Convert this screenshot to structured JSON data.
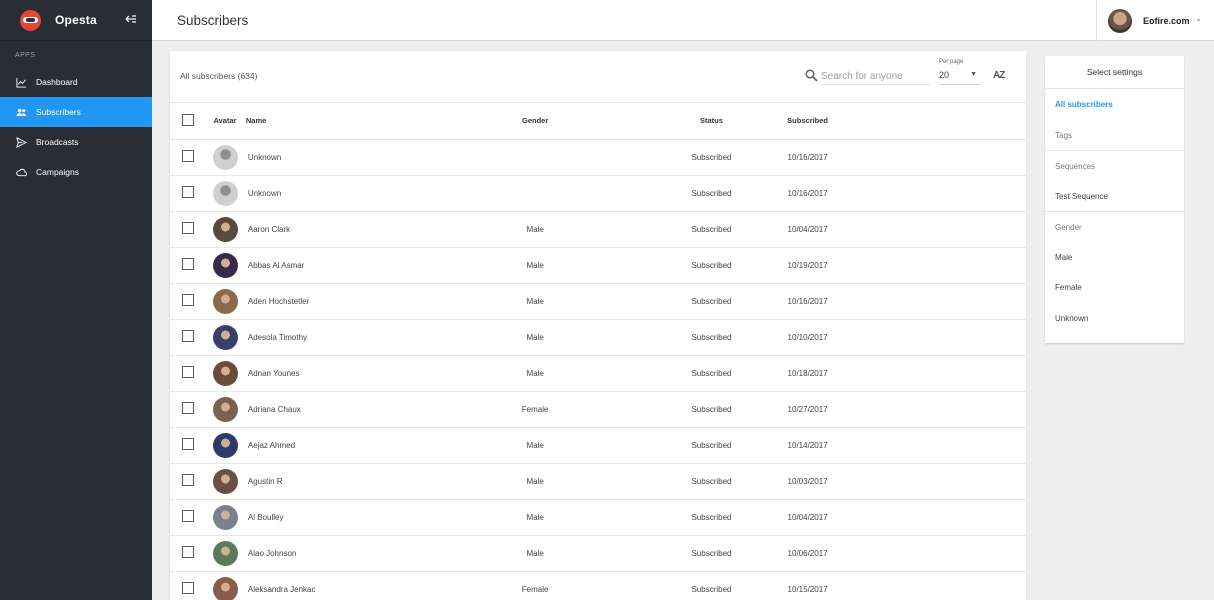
{
  "brand": {
    "name": "Opesta"
  },
  "sidebar": {
    "section_label": "APPS",
    "items": [
      {
        "label": "Dashboard",
        "icon": "chart-line-icon"
      },
      {
        "label": "Subscribers",
        "icon": "people-icon"
      },
      {
        "label": "Broadcasts",
        "icon": "send-icon"
      },
      {
        "label": "Campaigns",
        "icon": "cloud-icon"
      }
    ]
  },
  "header": {
    "title": "Subscribers",
    "user_name": "Eofire.com"
  },
  "toolbar": {
    "all_count": "All subscribers (634)",
    "search_placeholder": "Search for anyone",
    "per_page_label": "Per page",
    "per_page_value": "20",
    "sort_label": "AZ"
  },
  "table": {
    "headers": {
      "avatar": "Avatar",
      "name": "Name",
      "gender": "Gender",
      "status": "Status",
      "subscribed": "Subscribed"
    },
    "rows": [
      {
        "name": "Unknown",
        "gender": "",
        "status": "Subscribed",
        "date": "10/16/2017",
        "color": "#9e9e9e"
      },
      {
        "name": "Unknown",
        "gender": "",
        "status": "Subscribed",
        "date": "10/16/2017",
        "color": "#9e9e9e"
      },
      {
        "name": "Aaron Clark",
        "gender": "Male",
        "status": "Subscribed",
        "date": "10/04/2017",
        "color": "#5a4a3e"
      },
      {
        "name": "Abbas Al Asmar",
        "gender": "Male",
        "status": "Subscribed",
        "date": "10/19/2017",
        "color": "#3a2a4a"
      },
      {
        "name": "Aden Hochstetler",
        "gender": "Male",
        "status": "Subscribed",
        "date": "10/16/2017",
        "color": "#8a6a4a"
      },
      {
        "name": "Adesola Timothy",
        "gender": "Male",
        "status": "Subscribed",
        "date": "10/10/2017",
        "color": "#3b3d6b"
      },
      {
        "name": "Adnan Younes",
        "gender": "Male",
        "status": "Subscribed",
        "date": "10/18/2017",
        "color": "#6b4a3a"
      },
      {
        "name": "Adriana Chaux",
        "gender": "Female",
        "status": "Subscribed",
        "date": "10/27/2017",
        "color": "#7a6050"
      },
      {
        "name": "Aejaz Ahmed",
        "gender": "Male",
        "status": "Subscribed",
        "date": "10/14/2017",
        "color": "#2a3a6a"
      },
      {
        "name": "Agustin R",
        "gender": "Male",
        "status": "Subscribed",
        "date": "10/03/2017",
        "color": "#6a5040"
      },
      {
        "name": "Al Boulley",
        "gender": "Male",
        "status": "Subscribed",
        "date": "10/04/2017",
        "color": "#7a8090"
      },
      {
        "name": "Alao Johnson",
        "gender": "Male",
        "status": "Subscribed",
        "date": "10/06/2017",
        "color": "#5a7a5a"
      },
      {
        "name": "Aleksandra Jenkac",
        "gender": "Female",
        "status": "Subscribed",
        "date": "10/15/2017",
        "color": "#8a5a4a"
      }
    ]
  },
  "settings": {
    "title": "Select settings",
    "all": "All subscribers",
    "tags": "Tags",
    "sequences": "Sequences",
    "test_sequence": "Test Sequence",
    "gender": "Gender",
    "male": "Male",
    "female": "Female",
    "unknown": "Unknown"
  },
  "colors": {
    "accent": "#2196f3",
    "sidebar_bg": "#2b2d35"
  }
}
